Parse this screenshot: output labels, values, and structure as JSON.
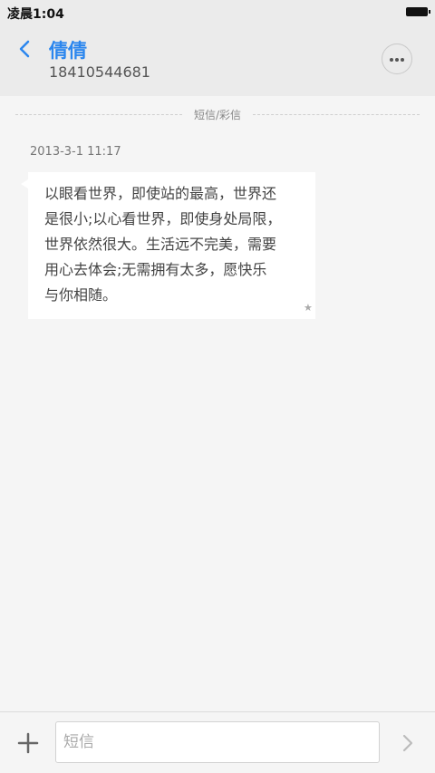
{
  "status_bar": {
    "time": "凌晨1:04"
  },
  "header": {
    "contact_name": "倩倩",
    "phone_number": "18410544681",
    "back_icon": "chevron-left-icon",
    "more_icon": "more-horizontal-icon"
  },
  "thread": {
    "divider_label": "短信/彩信",
    "timestamp": "2013-3-1 11:17",
    "messages": [
      {
        "text": "以眼看世界，即使站的最高，世界还\n是很小;以心看世界，即使身处局限，\n世界依然很大。生活远不完美，需要\n用心去体会;无需拥有太多，愿快乐\n与你相随。",
        "starred": true
      }
    ]
  },
  "composer": {
    "placeholder": "短信",
    "value": "",
    "add_icon": "plus-icon",
    "send_icon": "chevron-right-icon"
  },
  "colors": {
    "accent": "#2b86ee",
    "background": "#f5f5f5",
    "header_background": "#ebebeb",
    "bubble": "#ffffff"
  }
}
